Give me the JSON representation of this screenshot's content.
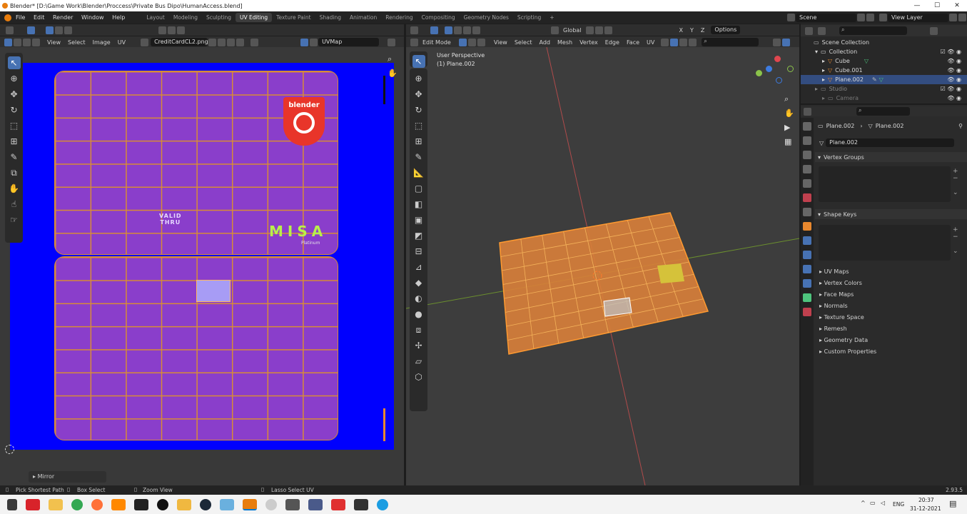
{
  "window": {
    "title": "Blender* [D:\\Game Work\\Blender\\Proccess\\Private Bus Dipo\\HumanAccess.blend]",
    "controls": [
      "—",
      "☐",
      "✕"
    ]
  },
  "menu": [
    "File",
    "Edit",
    "Render",
    "Window",
    "Help"
  ],
  "workspaces": [
    {
      "label": "Layout"
    },
    {
      "label": "Modeling"
    },
    {
      "label": "Sculpting"
    },
    {
      "label": "UV Editing",
      "active": true
    },
    {
      "label": "Texture Paint"
    },
    {
      "label": "Shading"
    },
    {
      "label": "Animation"
    },
    {
      "label": "Rendering"
    },
    {
      "label": "Compositing"
    },
    {
      "label": "Geometry Nodes"
    },
    {
      "label": "Scripting"
    },
    {
      "label": "+"
    }
  ],
  "scene": {
    "name": "Scene",
    "view_layer": "View Layer"
  },
  "uv_editor": {
    "menu": [
      "View",
      "Select",
      "Image",
      "UV"
    ],
    "image_name": "CreditCardCL2.png",
    "uvmap": "UVMap",
    "card_text": {
      "valid": "VALID",
      "thru": "THRU",
      "brand": "MISA",
      "tier": "Platinum",
      "logo": "blender"
    },
    "panel": "Mirror"
  },
  "viewport": {
    "mode": "Edit Mode",
    "menu": [
      "View",
      "Select",
      "Add",
      "Mesh",
      "Vertex",
      "Edge",
      "Face",
      "UV"
    ],
    "orientation": "Global",
    "options": "Options",
    "info_line1": "User Perspective",
    "info_line2": "(1) Plane.002",
    "axes": [
      "X",
      "Y",
      "Z"
    ]
  },
  "outliner": {
    "root": "Scene Collection",
    "items": [
      {
        "label": "Collection",
        "level": 1
      },
      {
        "label": "Cube",
        "level": 2
      },
      {
        "label": "Cube.001",
        "level": 2
      },
      {
        "label": "Plane.002",
        "level": 2
      },
      {
        "label": "Studio",
        "level": 1
      },
      {
        "label": "Camera",
        "level": 2
      }
    ]
  },
  "properties": {
    "object": "Plane.002",
    "mesh": "Plane.002",
    "datablock": "Plane.002",
    "sections": [
      "Vertex Groups",
      "Shape Keys"
    ],
    "panels": [
      "UV Maps",
      "Vertex Colors",
      "Face Maps",
      "Normals",
      "Texture Space",
      "Remesh",
      "Geometry Data",
      "Custom Properties"
    ]
  },
  "statusbar": {
    "pick": "Pick Shortest Path",
    "box": "Box Select",
    "zoom": "Zoom View",
    "lasso": "Lasso Select UV",
    "version": "2.93.5"
  },
  "taskbar": {
    "lang": "ENG",
    "time": "20:37",
    "date": "31-12-2021",
    "tray": "^"
  },
  "colors": {
    "accent": "#4772b3",
    "texture_bg": "#0000fe",
    "card": "#8a3ecb",
    "uv_edge": "#d78b37",
    "mesh": "#e8882e",
    "blender_orange": "#e87d0d"
  }
}
